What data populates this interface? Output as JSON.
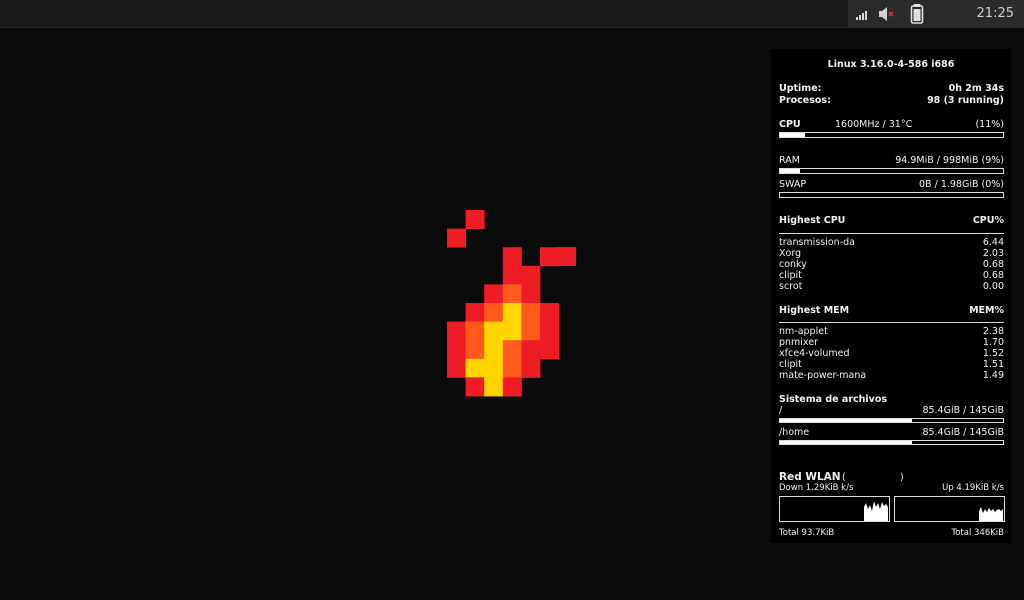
{
  "top_panel": {
    "clock": "21:25",
    "icons": [
      "signal-strength-icon",
      "volume-muted-icon",
      "clipboard-icon"
    ]
  },
  "conky": {
    "kernel": "Linux 3.16.0-4-586 i686",
    "uptime_label": "Uptime:",
    "uptime_value": "0h 2m 34s",
    "processes_label": "Procesos:",
    "processes_value": "98 (3 running)",
    "cpu_label": "CPU",
    "cpu_freq_temp": "1600MHz / 31°C",
    "cpu_percent": "(11%)",
    "cpu_usage": 0.11,
    "ram_label": "RAM",
    "ram_value": "94.9MiB / 998MiB (9%)",
    "ram_usage": 0.09,
    "swap_label": "SWAP",
    "swap_value": "0B   / 1.98GiB (0%)",
    "swap_usage": 0.0,
    "highest_cpu_label": "Highest CPU",
    "cpu_pct_header": "CPU%",
    "top_cpu": [
      {
        "name": "transmission-da",
        "value": "6.44"
      },
      {
        "name": "Xorg",
        "value": "2.03"
      },
      {
        "name": "conky",
        "value": "0.68"
      },
      {
        "name": "clipit",
        "value": "0.68"
      },
      {
        "name": "scrot",
        "value": "0.00"
      }
    ],
    "highest_mem_label": "Highest MEM",
    "mem_pct_header": "MEM%",
    "top_mem": [
      {
        "name": "nm-applet",
        "value": "2.38"
      },
      {
        "name": "pnmixer",
        "value": "1.70"
      },
      {
        "name": "xfce4-volumed",
        "value": "1.52"
      },
      {
        "name": "clipit",
        "value": "1.51"
      },
      {
        "name": "mate-power-mana",
        "value": "1.49"
      }
    ],
    "filesystem_label": "Sistema de archivos",
    "filesystems": [
      {
        "mount": "/",
        "usage_text": "85.4GiB / 145GiB",
        "usage": 0.59
      },
      {
        "mount": "/home",
        "usage_text": "85.4GiB / 145GiB",
        "usage": 0.59
      }
    ],
    "network_label": "Red WLAN",
    "network_paren_open": "(",
    "network_paren_close": ")",
    "down_speed": "Down 1.29KiB k/s",
    "up_speed": "Up 4.19KiB k/s",
    "total_down": "Total 93.7KiB",
    "total_up": "Total 346KiB"
  },
  "colors": {
    "background": "#0b0b0b",
    "panel": "#1a1a1a",
    "conky_bg": "#000000",
    "text": "#ffffff",
    "flame_red": "#ee1c24",
    "flame_orange": "#ff5a1e",
    "flame_yellow": "#ffd400"
  }
}
